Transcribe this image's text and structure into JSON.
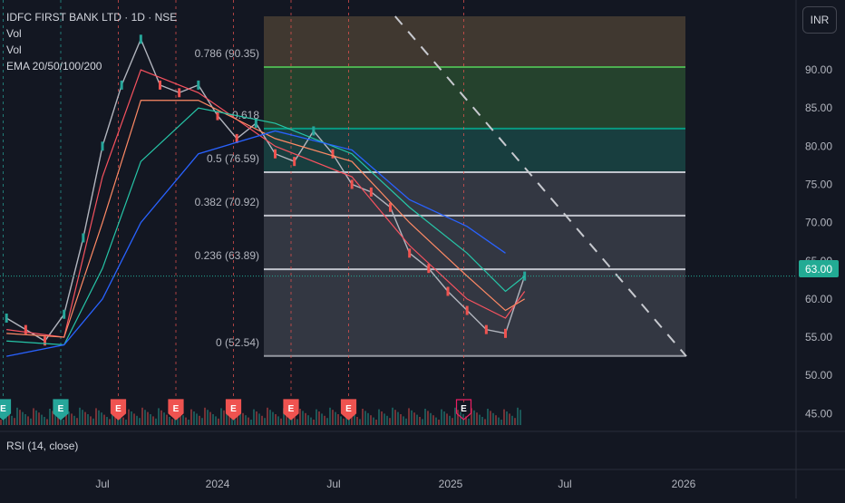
{
  "legend": {
    "symbol": "IDFC FIRST BANK LTD · 1D · NSE",
    "vol1": "Vol",
    "vol2": "Vol",
    "ema": "EMA 20/50/100/200"
  },
  "currency_button": "INR",
  "last_price": "63.00",
  "rsi_label": "RSI (14, close)",
  "colors": {
    "background": "#131722",
    "up": "#26a69a",
    "down": "#ef5350",
    "ema20": "#f7525f",
    "ema50": "#ff8a65",
    "ema100": "#26c6a8",
    "ema200": "#2962ff",
    "last_price": "#22ab94"
  },
  "chart_data": {
    "type": "candlestick",
    "title": "IDFC FIRST BANK LTD · 1D · NSE",
    "y_axis": {
      "ticks": [
        45,
        50,
        55,
        60,
        65,
        70,
        75,
        80,
        85,
        90
      ],
      "ylim": [
        43.5,
        97
      ],
      "currency": "INR"
    },
    "x_axis": {
      "labels": [
        "Jul",
        "2024",
        "Jul",
        "2025",
        "Jul",
        "2026"
      ]
    },
    "fibonacci": [
      {
        "level": "0",
        "price": 52.54,
        "label": "0 (52.54)"
      },
      {
        "level": "0.236",
        "price": 63.89,
        "label": "0.236 (63.89)"
      },
      {
        "level": "0.382",
        "price": 70.92,
        "label": "0.382 (70.92)"
      },
      {
        "level": "0.5",
        "price": 76.59,
        "label": "0.5 (76.59)"
      },
      {
        "level": "0.618",
        "price": 82.3,
        "label": "0.618"
      },
      {
        "level": "0.786",
        "price": 90.35,
        "label": "0.786 (90.35)"
      }
    ],
    "price_path": [
      [
        "2023-02",
        57.5
      ],
      [
        "2023-03",
        56
      ],
      [
        "2023-04",
        54.5
      ],
      [
        "2023-05",
        58
      ],
      [
        "2023-06",
        68
      ],
      [
        "2023-07",
        80
      ],
      [
        "2023-08",
        88
      ],
      [
        "2023-09",
        94
      ],
      [
        "2023-10",
        88
      ],
      [
        "2023-11",
        87
      ],
      [
        "2023-12",
        88
      ],
      [
        "2024-01",
        84
      ],
      [
        "2024-02",
        81
      ],
      [
        "2024-03",
        83
      ],
      [
        "2024-04",
        79
      ],
      [
        "2024-05",
        78
      ],
      [
        "2024-06",
        82
      ],
      [
        "2024-07",
        79
      ],
      [
        "2024-08",
        75
      ],
      [
        "2024-09",
        74
      ],
      [
        "2024-10",
        72
      ],
      [
        "2024-11",
        66
      ],
      [
        "2024-12",
        64
      ],
      [
        "2025-01",
        61
      ],
      [
        "2025-02",
        58.5
      ],
      [
        "2025-03",
        56
      ],
      [
        "2025-04",
        55.5
      ],
      [
        "2025-05",
        63
      ]
    ],
    "ema_series": [
      {
        "period": 20,
        "values": [
          [
            "2023-02",
            56
          ],
          [
            "2023-05",
            55
          ],
          [
            "2023-07",
            76
          ],
          [
            "2023-09",
            90
          ],
          [
            "2023-12",
            87
          ],
          [
            "2024-04",
            80
          ],
          [
            "2024-08",
            76
          ],
          [
            "2024-11",
            67
          ],
          [
            "2025-02",
            60
          ],
          [
            "2025-04",
            57.5
          ],
          [
            "2025-05",
            61
          ]
        ]
      },
      {
        "period": 50,
        "values": [
          [
            "2023-02",
            55.5
          ],
          [
            "2023-05",
            55
          ],
          [
            "2023-07",
            70
          ],
          [
            "2023-09",
            86
          ],
          [
            "2023-12",
            86
          ],
          [
            "2024-04",
            81
          ],
          [
            "2024-08",
            78
          ],
          [
            "2024-11",
            70
          ],
          [
            "2025-02",
            63
          ],
          [
            "2025-04",
            58.5
          ],
          [
            "2025-05",
            60
          ]
        ]
      },
      {
        "period": 100,
        "values": [
          [
            "2023-02",
            54.5
          ],
          [
            "2023-05",
            54
          ],
          [
            "2023-07",
            64
          ],
          [
            "2023-09",
            78
          ],
          [
            "2023-12",
            85
          ],
          [
            "2024-04",
            83
          ],
          [
            "2024-08",
            79
          ],
          [
            "2024-11",
            72
          ],
          [
            "2025-02",
            66
          ],
          [
            "2025-04",
            61
          ],
          [
            "2025-05",
            63
          ]
        ]
      },
      {
        "period": 200,
        "values": [
          [
            "2023-02",
            52.5
          ],
          [
            "2023-05",
            54
          ],
          [
            "2023-07",
            60
          ],
          [
            "2023-09",
            70
          ],
          [
            "2023-12",
            79
          ],
          [
            "2024-04",
            82
          ],
          [
            "2024-08",
            79.5
          ],
          [
            "2024-11",
            73
          ],
          [
            "2025-02",
            69.5
          ],
          [
            "2025-04",
            66
          ]
        ]
      }
    ],
    "trendline": {
      "from": [
        "2024-06",
        97
      ],
      "to": [
        "2026-01",
        52.5
      ],
      "style": "dashed"
    },
    "earnings_markers": [
      {
        "date": "2023-04",
        "label": "E",
        "kind": "up"
      },
      {
        "date": "2023-07",
        "label": "E",
        "kind": "up"
      },
      {
        "date": "2023-10",
        "label": "E",
        "kind": "down"
      },
      {
        "date": "2024-01",
        "label": "E",
        "kind": "down"
      },
      {
        "date": "2024-04",
        "label": "E",
        "kind": "down"
      },
      {
        "date": "2024-07",
        "label": "E",
        "kind": "down"
      },
      {
        "date": "2024-10",
        "label": "E",
        "kind": "down"
      },
      {
        "date": "2025-04",
        "label": "E",
        "kind": "upcoming"
      }
    ],
    "last_price": 63.0
  }
}
